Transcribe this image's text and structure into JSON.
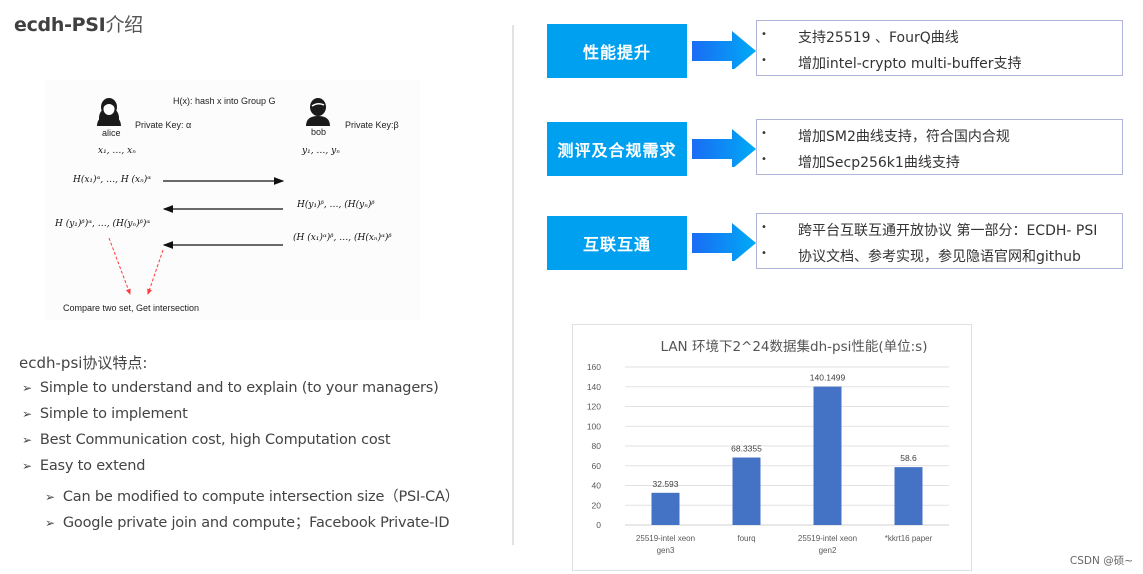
{
  "page": {
    "title_latin": "ecdh-PSI",
    "title_cn": "介绍",
    "watermark": "CSDN @硕~"
  },
  "diagram": {
    "hash_def": "H(x):  hash x into Group G",
    "alice": {
      "name": "alice",
      "key_label": "Private Key: α",
      "set": "x₁, …, xₙ"
    },
    "bob": {
      "name": "bob",
      "key_label": "Private Key:β",
      "set": "y₁, …, yₙ"
    },
    "msg1": "H(x₁)ᵅ, …, H (xₙ)ᵅ",
    "msg2": "H(y₁)ᵝ, …, (H(yₙ)ᵝ",
    "alice_compute": "H (y₁)ᵝ)ᵅ, …, (H(yₙ)ᵝ)ᵅ",
    "msg3": "(H (x₁)ᵅ)ᵝ, …, (H(xₙ)ᵅ)ᵝ",
    "compare": "Compare two set, Get intersection",
    "colors": {
      "arrow": "#111111",
      "dashed": "#ff3b3b"
    }
  },
  "features": {
    "title": "ecdh-psi协议特点:",
    "bullet": "➢",
    "items": [
      {
        "text": "Simple to understand and to explain (to your managers)",
        "level": 1
      },
      {
        "text": "Simple to implement",
        "level": 1
      },
      {
        "text": "Best Communication cost, high Computation cost",
        "level": 1
      },
      {
        "text": "Easy to extend",
        "level": 1
      },
      {
        "text": "Can be modified to compute intersection size（PSI-CA）",
        "level": 2
      },
      {
        "text": "Google private join and compute；Facebook Private-ID",
        "level": 2
      }
    ]
  },
  "improvements": {
    "accent": "#00a0f0",
    "bullet": "•",
    "groups": [
      {
        "tag": "性能提升",
        "items": [
          "支持25519 、FourQ曲线",
          "增加intel-crypto multi-buffer支持"
        ]
      },
      {
        "tag": "测评及合规需求",
        "items": [
          "增加SM2曲线支持，符合国内合规",
          "增加Secp256k1曲线支持"
        ]
      },
      {
        "tag": "互联互通",
        "items": [
          "跨平台互联互通开放协议 第一部分：ECDH- PSI",
          "协议文档、参考实现，参见隐语官网和github"
        ]
      }
    ]
  },
  "chart_data": {
    "type": "bar",
    "title": "LAN 环境下2^24数据集dh-psi性能(单位:s)",
    "categories": [
      "25519-intel xeon gen3",
      "fourq",
      "25519-intel xeon gen2",
      "*kkrt16 paper"
    ],
    "category_lines": [
      [
        "25519-intel xeon",
        "gen3"
      ],
      [
        "fourq"
      ],
      [
        "25519-intel xeon",
        "gen2"
      ],
      [
        "*kkrt16 paper"
      ]
    ],
    "values": [
      32.593,
      68.3355,
      140.1499,
      58.6
    ],
    "data_labels": [
      "32.593",
      "68.3355",
      "140.1499",
      "58.6"
    ],
    "xlabel": "",
    "ylabel": "",
    "ylim": [
      0,
      160
    ],
    "yticks": [
      0,
      20,
      40,
      60,
      80,
      100,
      120,
      140,
      160
    ],
    "grid": true,
    "legend": "none",
    "bar_color": "#4472c4"
  }
}
